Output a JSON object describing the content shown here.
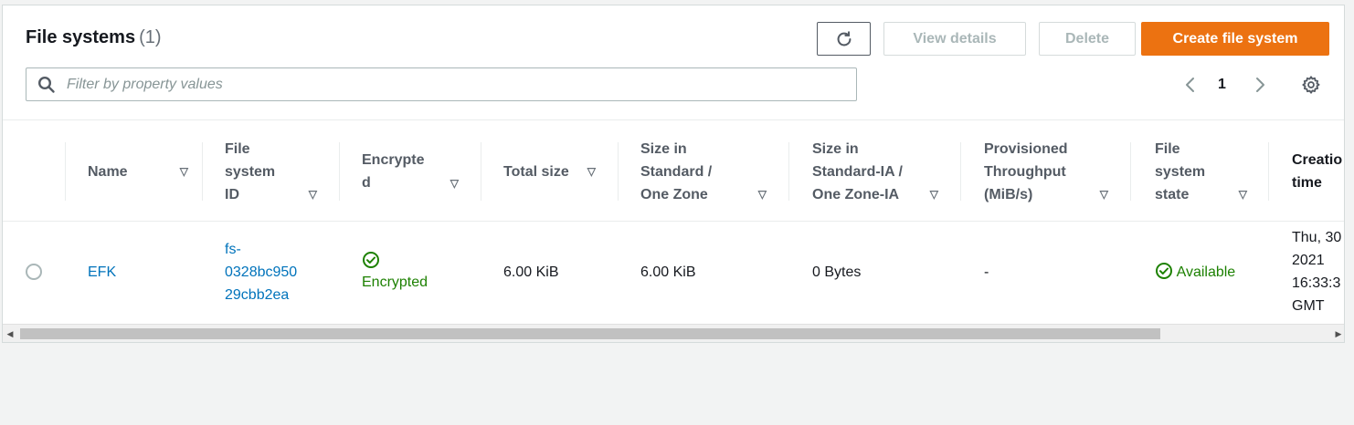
{
  "header": {
    "title": "File systems",
    "count": "(1)"
  },
  "toolbar": {
    "view_details_label": "View details",
    "delete_label": "Delete",
    "create_label": "Create file system"
  },
  "search": {
    "placeholder": "Filter by property values",
    "value": ""
  },
  "pagination": {
    "current_page": "1"
  },
  "table": {
    "columns": [
      {
        "lines": [
          "Name"
        ]
      },
      {
        "lines": [
          "File",
          "system",
          "ID"
        ]
      },
      {
        "lines": [
          "Encrypte",
          "d"
        ]
      },
      {
        "lines": [
          "Total size"
        ]
      },
      {
        "lines": [
          "Size in",
          "Standard /",
          "One Zone"
        ]
      },
      {
        "lines": [
          "Size in",
          "Standard-IA /",
          "One Zone-IA"
        ]
      },
      {
        "lines": [
          "Provisioned",
          "Throughput",
          "(MiB/s)"
        ]
      },
      {
        "lines": [
          "File",
          "system",
          "state"
        ]
      },
      {
        "lines": [
          "Creatio",
          "time"
        ]
      }
    ],
    "rows": [
      {
        "name": "EFK",
        "id_lines": [
          "fs-",
          "0328bc950",
          "29cbb2ea"
        ],
        "encrypted": "Encrypted",
        "total_size": "6.00 KiB",
        "size_standard": "6.00 KiB",
        "size_ia": "0 Bytes",
        "throughput": "-",
        "state": "Available",
        "created_lines": [
          "Thu, 30",
          "2021",
          "16:33:3",
          "GMT"
        ]
      }
    ]
  },
  "colors": {
    "primary_button": "#ec7211",
    "link": "#0073bb",
    "success": "#1d8102"
  },
  "icons": [
    "refresh-icon",
    "search-icon",
    "chevron-left-icon",
    "chevron-right-icon",
    "gear-icon",
    "sort-icon",
    "check-circle-icon"
  ]
}
